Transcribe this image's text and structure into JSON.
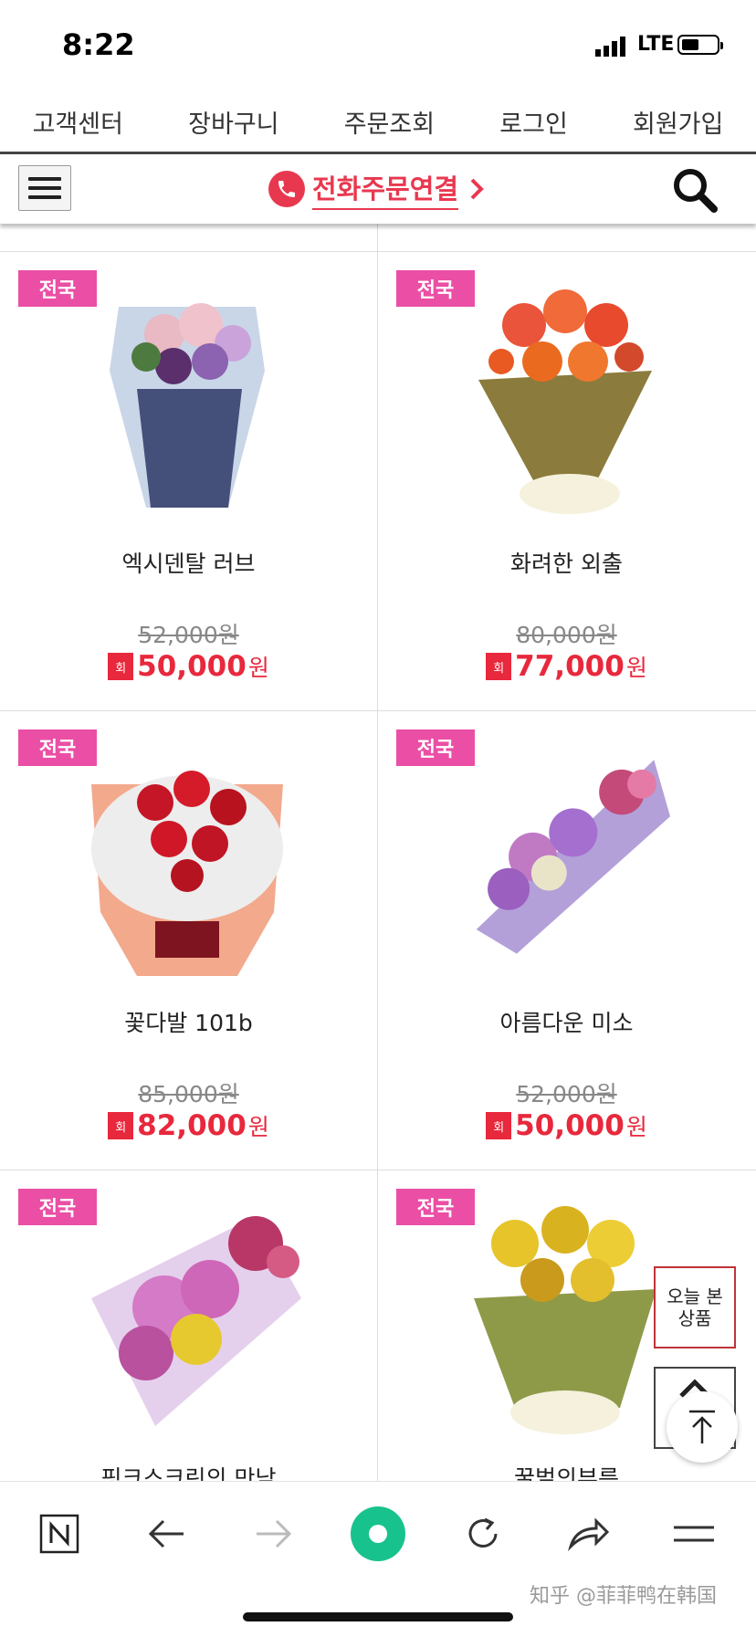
{
  "status_bar": {
    "time": "8:22",
    "network": "LTE",
    "battery_level": 0.45
  },
  "top_nav": [
    "고객센터",
    "장바구니",
    "주문조회",
    "로그인",
    "회원가입"
  ],
  "header": {
    "phone_order": "전화주문연결",
    "accent_color": "#e8384f"
  },
  "products": [
    {
      "badge": "전국",
      "name": "엑시덴탈 러브",
      "old_price": "52,000원",
      "sale_tag": "회",
      "price": "50,000",
      "won": "원"
    },
    {
      "badge": "전국",
      "name": "화려한 외출",
      "old_price": "80,000원",
      "sale_tag": "회",
      "price": "77,000",
      "won": "원"
    },
    {
      "badge": "전국",
      "name": "꽃다발 101b",
      "old_price": "85,000원",
      "sale_tag": "회",
      "price": "82,000",
      "won": "원"
    },
    {
      "badge": "전국",
      "name": "아름다운 미소",
      "old_price": "52,000원",
      "sale_tag": "회",
      "price": "50,000",
      "won": "원"
    },
    {
      "badge": "전국",
      "name": "핑크스크린의 만남",
      "old_price": "",
      "sale_tag": "",
      "price": "",
      "won": ""
    },
    {
      "badge": "전국",
      "name": "꿀벌의부름",
      "old_price": "",
      "sale_tag": "",
      "price": "",
      "won": ""
    }
  ],
  "side": {
    "recently_viewed": "오늘 본\n상품"
  },
  "toolbar": {
    "icons": [
      "naver-n-icon",
      "back-arrow-icon",
      "forward-arrow-icon",
      "green-home-icon",
      "refresh-icon",
      "share-icon",
      "menu-icon"
    ]
  },
  "watermark": "知乎 @菲菲鸭在韩国"
}
